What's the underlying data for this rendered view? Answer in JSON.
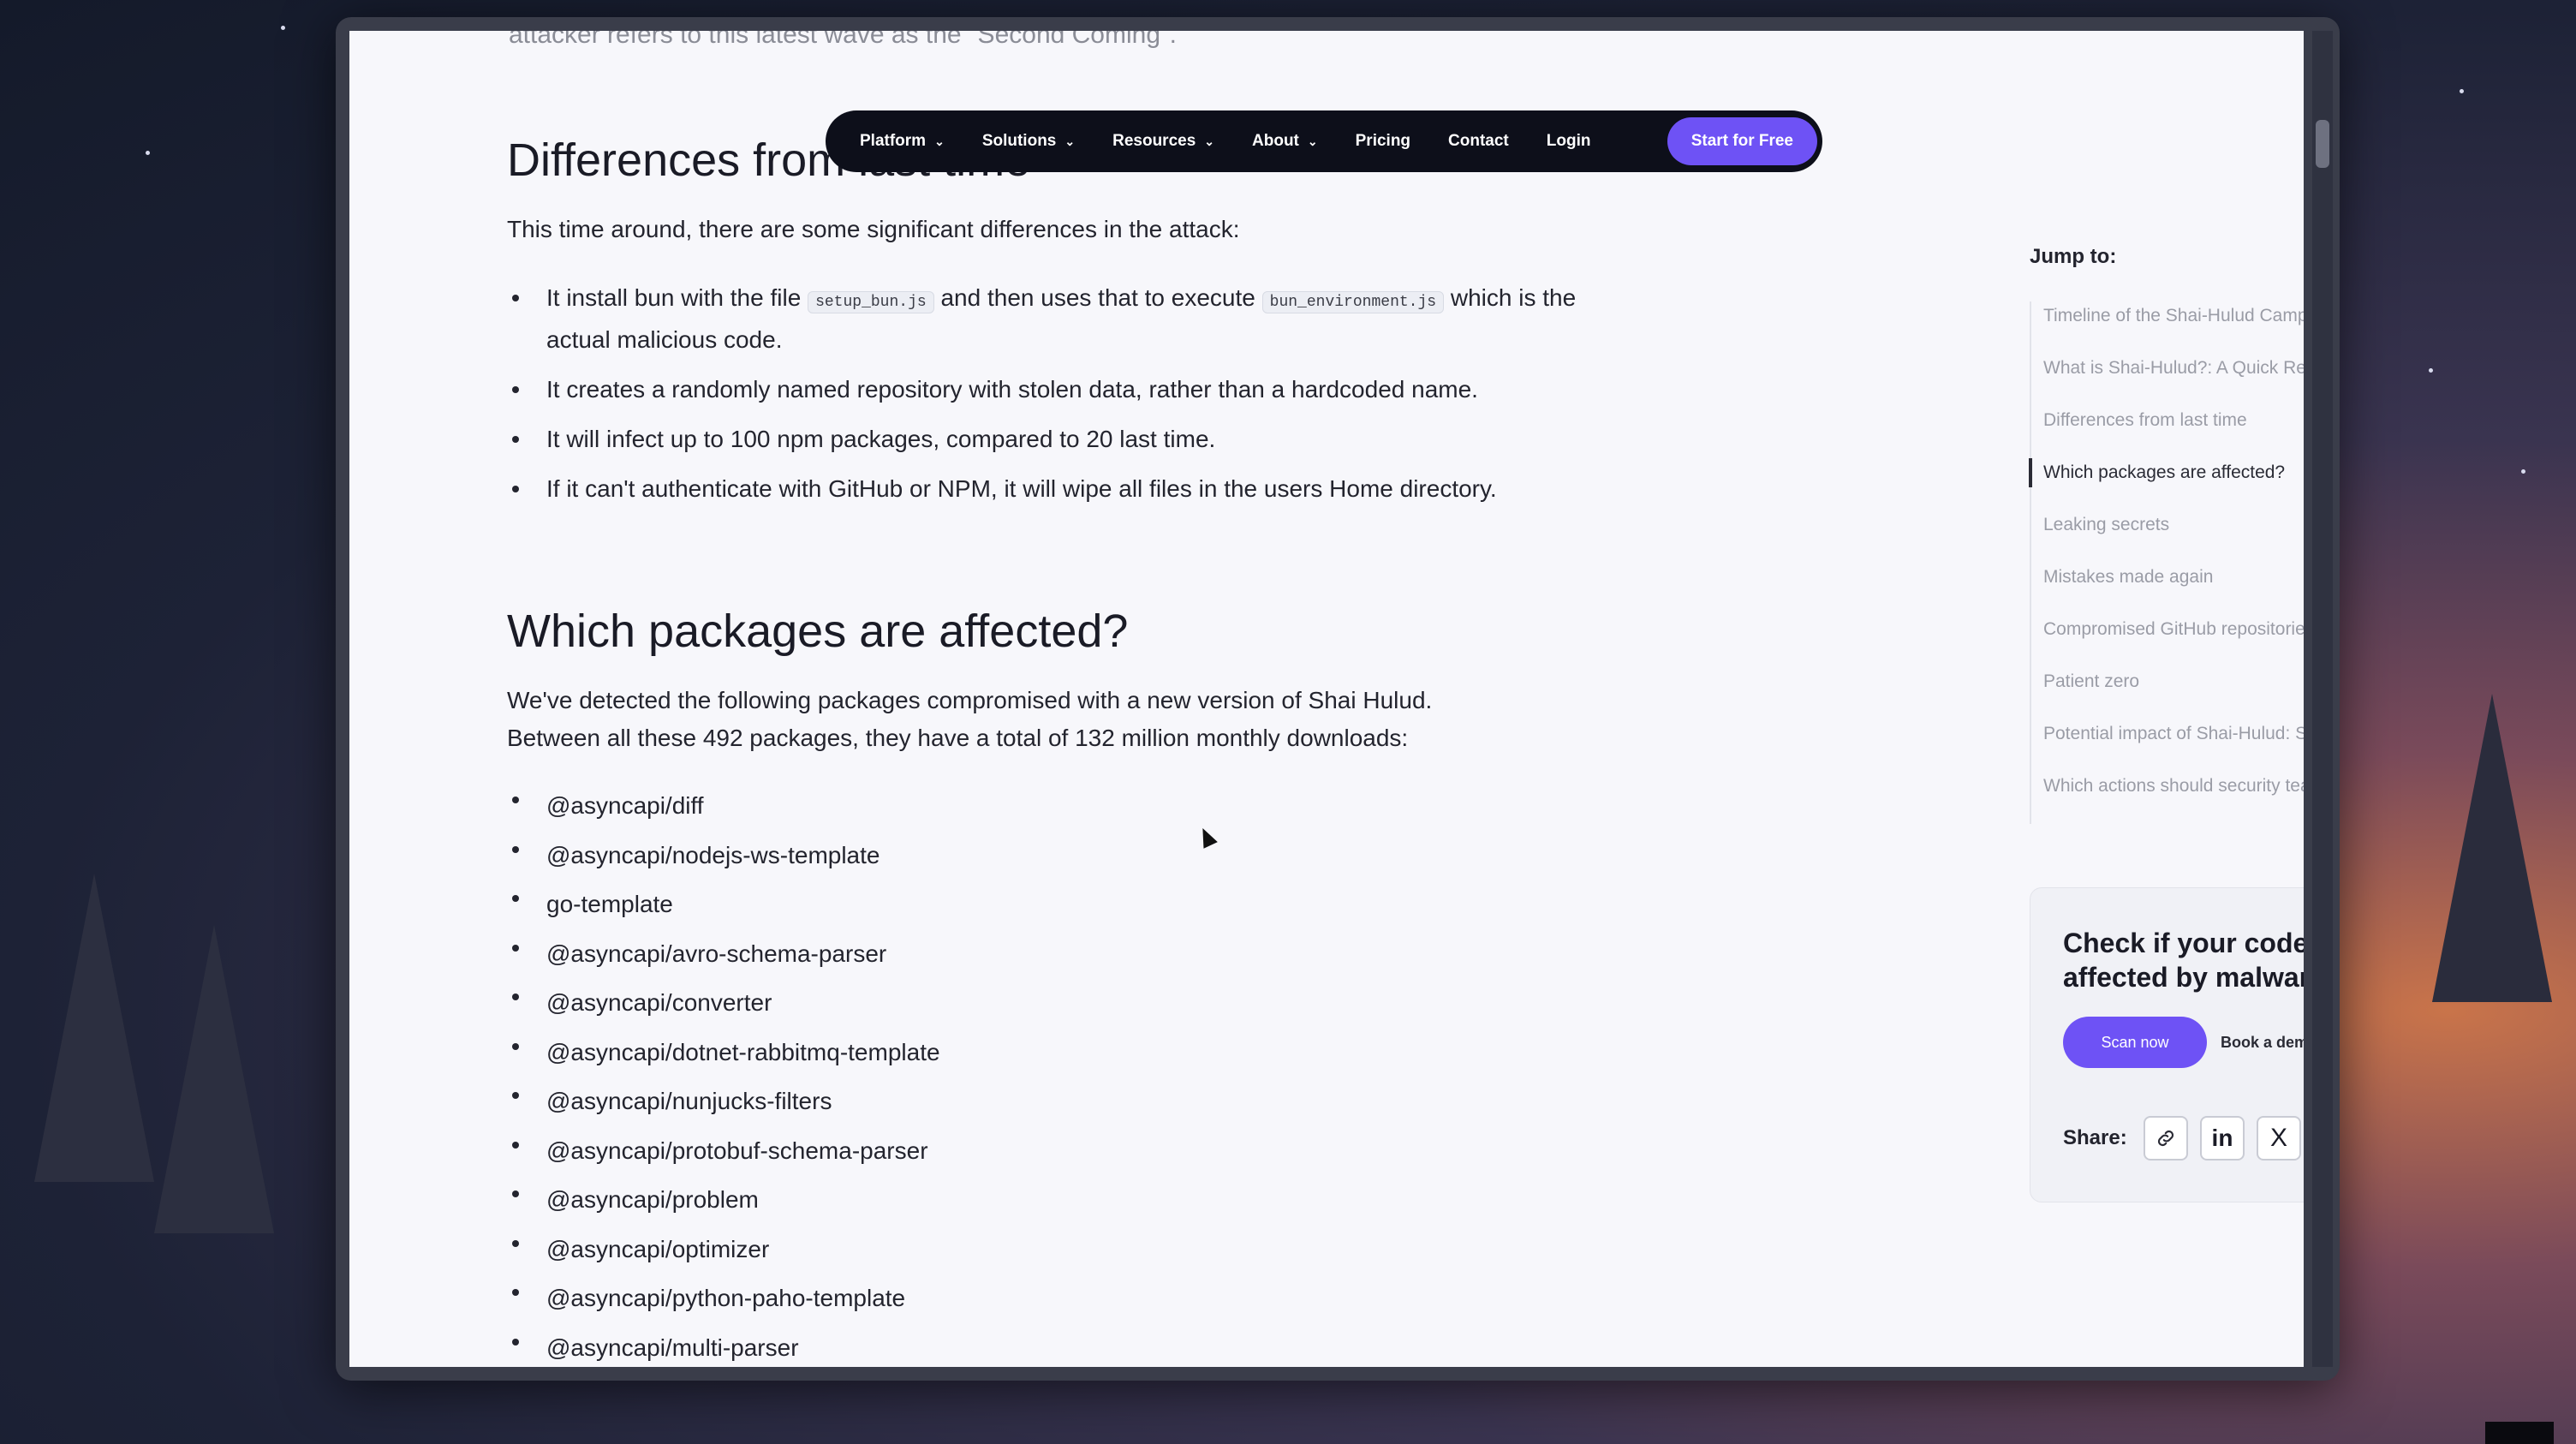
{
  "header_fragment": "attacker refers to this latest wave as the \"Second Coming\".",
  "nav": {
    "items": [
      {
        "label": "Platform",
        "dropdown": true
      },
      {
        "label": "Solutions",
        "dropdown": true
      },
      {
        "label": "Resources",
        "dropdown": true
      },
      {
        "label": "About",
        "dropdown": true
      },
      {
        "label": "Pricing",
        "dropdown": false
      },
      {
        "label": "Contact",
        "dropdown": false
      },
      {
        "label": "Login",
        "dropdown": false
      }
    ],
    "cta": "Start for Free"
  },
  "section_diff": {
    "heading": "Differences from last time",
    "intro": "This time around, there are some significant differences in the attack:",
    "bullet1": {
      "pre": "It install bun with the file",
      "code1": "setup_bun.js",
      "mid": "and then uses that to execute",
      "code2": "bun_environment.js",
      "post": "which is the actual malicious code."
    },
    "bullet2": "It creates a randomly named repository with stolen data, rather than a hardcoded name.",
    "bullet3": "It will infect up to 100 npm packages, compared to 20 last time.",
    "bullet4": "If it can't authenticate with GitHub or NPM, it will wipe all files in the users Home directory."
  },
  "section_which": {
    "heading": "Which packages are affected?",
    "intro_line1": "We've detected the following packages compromised with a new version of Shai Hulud.",
    "intro_line2": "Between all these 492 packages, they have a total of 132 million monthly downloads:",
    "packages": [
      "@asyncapi/diff",
      "@asyncapi/nodejs-ws-template",
      "go-template",
      "@asyncapi/avro-schema-parser",
      "@asyncapi/converter",
      "@asyncapi/dotnet-rabbitmq-template",
      "@asyncapi/nunjucks-filters",
      "@asyncapi/protobuf-schema-parser",
      "@asyncapi/problem",
      "@asyncapi/optimizer",
      "@asyncapi/python-paho-template",
      "@asyncapi/multi-parser"
    ]
  },
  "toc": {
    "title": "Jump to:",
    "items": [
      "Timeline of the Shai-Hulud Campaign",
      "What is Shai-Hulud?: A Quick Refresher",
      "Differences from last time",
      "Which packages are affected?",
      "Leaking secrets",
      "Mistakes made again",
      "Compromised GitHub repositories",
      "Patient zero",
      "Potential impact of Shai-Hulud: Second Coming",
      "Which actions should security teams take?"
    ],
    "active_index": 3
  },
  "cta_card": {
    "title": "Check if your code has been affected by malware",
    "scan_label": "Scan now",
    "demo_label": "Book a demo",
    "arrow": "→",
    "share_label": "Share:",
    "linkedin_label": "in",
    "x_label": "X"
  },
  "icons": {
    "chevron": "⌄"
  },
  "colors": {
    "accent": "#6e52f5",
    "nav_bg": "#0d0f1a",
    "page_bg": "#f7f7fb"
  }
}
